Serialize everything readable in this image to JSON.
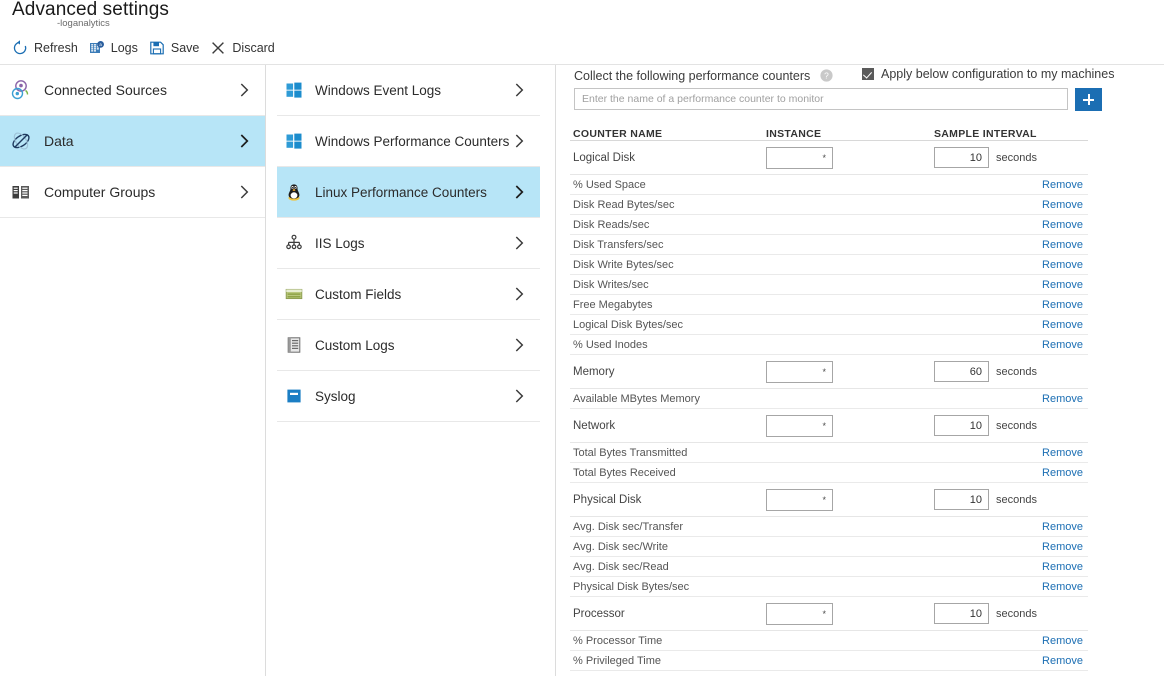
{
  "header": {
    "title": "Advanced settings",
    "subtitle": "-loganalytics"
  },
  "toolbar": {
    "refresh_label": "Refresh",
    "logs_label": "Logs",
    "save_label": "Save",
    "discard_label": "Discard",
    "icons": [
      "refresh-icon",
      "logs-icon",
      "save-icon",
      "discard-icon"
    ]
  },
  "sidebar": {
    "items": [
      {
        "label": "Connected Sources",
        "icon": "connected-sources-icon",
        "selected": false
      },
      {
        "label": "Data",
        "icon": "data-icon",
        "selected": true
      },
      {
        "label": "Computer Groups",
        "icon": "computer-groups-icon",
        "selected": false
      }
    ]
  },
  "datasources": {
    "items": [
      {
        "label": "Windows Event Logs",
        "icon": "windows-logo-icon",
        "selected": false
      },
      {
        "label": "Windows Performance Counters",
        "icon": "windows-logo-icon",
        "selected": false
      },
      {
        "label": "Linux Performance Counters",
        "icon": "linux-penguin-icon",
        "selected": true
      },
      {
        "label": "IIS Logs",
        "icon": "hierarchy-icon",
        "selected": false
      },
      {
        "label": "Custom Fields",
        "icon": "custom-fields-icon",
        "selected": false
      },
      {
        "label": "Custom Logs",
        "icon": "custom-logs-icon",
        "selected": false
      },
      {
        "label": "Syslog",
        "icon": "syslog-icon",
        "selected": false
      }
    ]
  },
  "panel": {
    "collect_label": "Collect the following performance counters",
    "help_icon": "help-icon",
    "apply_label": "Apply below configuration to my machines",
    "apply_checked": true,
    "input_placeholder": "Enter the name of a performance counter to monitor",
    "input_value": "",
    "add_button_label": "+",
    "columns": {
      "name": "COUNTER NAME",
      "instance": "INSTANCE",
      "sample": "SAMPLE INTERVAL"
    },
    "seconds_unit": "seconds",
    "remove_label": "Remove",
    "groups": [
      {
        "name": "Logical Disk",
        "instance": "*",
        "interval": "10",
        "counters": [
          "% Used Space",
          "Disk Read Bytes/sec",
          "Disk Reads/sec",
          "Disk Transfers/sec",
          "Disk Write Bytes/sec",
          "Disk Writes/sec",
          "Free Megabytes",
          "Logical Disk Bytes/sec",
          "% Used Inodes"
        ]
      },
      {
        "name": "Memory",
        "instance": "*",
        "interval": "60",
        "counters": [
          "Available MBytes Memory"
        ]
      },
      {
        "name": "Network",
        "instance": "*",
        "interval": "10",
        "counters": [
          "Total Bytes Transmitted",
          "Total Bytes Received"
        ]
      },
      {
        "name": "Physical Disk",
        "instance": "*",
        "interval": "10",
        "counters": [
          "Avg. Disk sec/Transfer",
          "Avg. Disk sec/Write",
          "Avg. Disk sec/Read",
          "Physical Disk Bytes/sec"
        ]
      },
      {
        "name": "Processor",
        "instance": "*",
        "interval": "10",
        "counters": [
          "% Processor Time",
          "% Privileged Time"
        ]
      }
    ]
  },
  "colors": {
    "accent_blue": "#1b6eb3",
    "selection_blue": "#b7e5f7",
    "link_blue": "#1b6eb3"
  }
}
